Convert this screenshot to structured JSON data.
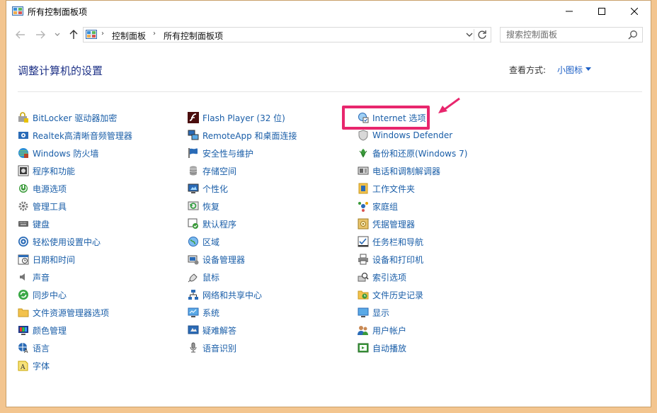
{
  "window": {
    "title": "所有控制面板项"
  },
  "address": {
    "crumbs": [
      "控制面板",
      "所有控制面板项"
    ],
    "search_placeholder": "搜索控制面板"
  },
  "header": {
    "heading": "调整计算机的设置",
    "view_by_label": "查看方式:",
    "view_by_value": "小图标"
  },
  "items": {
    "col1": [
      "BitLocker 驱动器加密",
      "Realtek高清晰音频管理器",
      "Windows 防火墙",
      "程序和功能",
      "电源选项",
      "管理工具",
      "键盘",
      "轻松使用设置中心",
      "日期和时间",
      "声音",
      "同步中心",
      "文件资源管理器选项",
      "颜色管理",
      "语言",
      "字体"
    ],
    "col2": [
      "Flash Player (32 位)",
      "RemoteApp 和桌面连接",
      "安全性与维护",
      "存储空间",
      "个性化",
      "恢复",
      "默认程序",
      "区域",
      "设备管理器",
      "鼠标",
      "网络和共享中心",
      "系统",
      "疑难解答",
      "语音识别"
    ],
    "col3": [
      "Internet 选项",
      "Windows Defender",
      "备份和还原(Windows 7)",
      "电话和调制解调器",
      "工作文件夹",
      "家庭组",
      "凭据管理器",
      "任务栏和导航",
      "设备和打印机",
      "索引选项",
      "文件历史记录",
      "显示",
      "用户帐户",
      "自动播放"
    ]
  },
  "colors": {
    "highlight": "#e8266d",
    "link": "#1a5ea8",
    "heading": "#1e3287"
  }
}
